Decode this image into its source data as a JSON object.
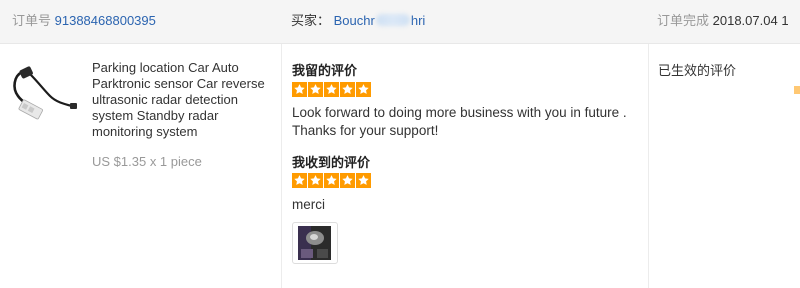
{
  "header": {
    "order_label": "订单号",
    "order_number": "91388468800395",
    "buyer_label": "买家：",
    "buyer_name_start": "Bouchr",
    "buyer_name_end": "hri",
    "status_label": "订单完成",
    "status_date": "2018.07.04 1"
  },
  "product": {
    "title": "Parking location Car Auto Parktronic sensor Car reverse ultrasonic radar detection system Standby radar monitoring system",
    "price": "US $1.35 x 1 piece",
    "thumbnail_icon": "parking-sensor-image"
  },
  "my_review": {
    "heading": "我留的评价",
    "rating": 5,
    "text": "Look forward to doing more business with you in future . Thanks for your support!"
  },
  "received_review": {
    "heading": "我收到的评价",
    "rating": 5,
    "text": "merci",
    "photo_icon": "review-photo-image"
  },
  "status": {
    "text": "已生效的评价"
  },
  "colors": {
    "star": "#ff9b00",
    "link": "#2b64b0",
    "header_bg": "#f5f5f5"
  }
}
